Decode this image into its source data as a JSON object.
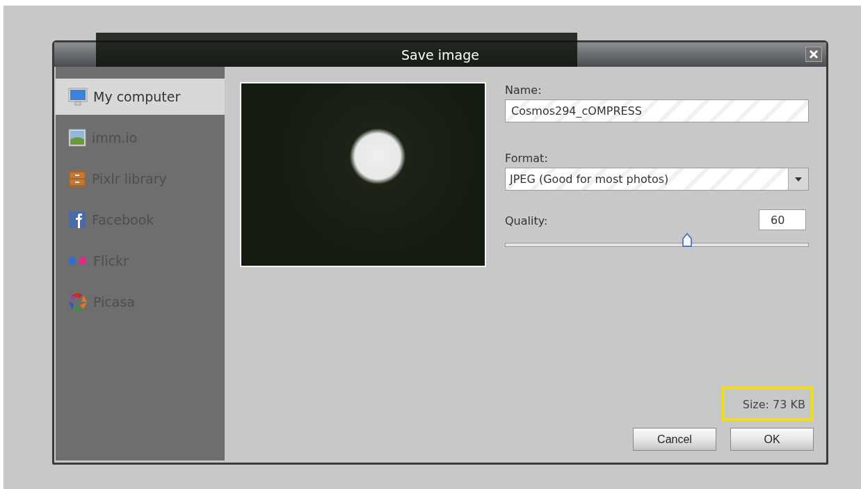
{
  "window": {
    "title": "Save image"
  },
  "sidebar": {
    "items": [
      {
        "label": "My computer",
        "kind": "computer",
        "selected": true
      },
      {
        "label": "imm.io",
        "kind": "picture",
        "selected": false
      },
      {
        "label": "Pixlr library",
        "kind": "cabinet",
        "selected": false
      },
      {
        "label": "Facebook",
        "kind": "facebook",
        "selected": false
      },
      {
        "label": "Flickr",
        "kind": "flickr",
        "selected": false
      },
      {
        "label": "Picasa",
        "kind": "picasa",
        "selected": false
      }
    ]
  },
  "form": {
    "name_label": "Name:",
    "name_value": "Cosmos294_cOMPRESS",
    "format_label": "Format:",
    "format_value": "JPEG (Good for most photos)",
    "quality_label": "Quality:",
    "quality_value": "60",
    "quality": {
      "level": 0.6
    }
  },
  "size": {
    "text": "Size: 73 KB",
    "highlighted": true
  },
  "buttons": [
    "Cancel",
    "OK"
  ]
}
